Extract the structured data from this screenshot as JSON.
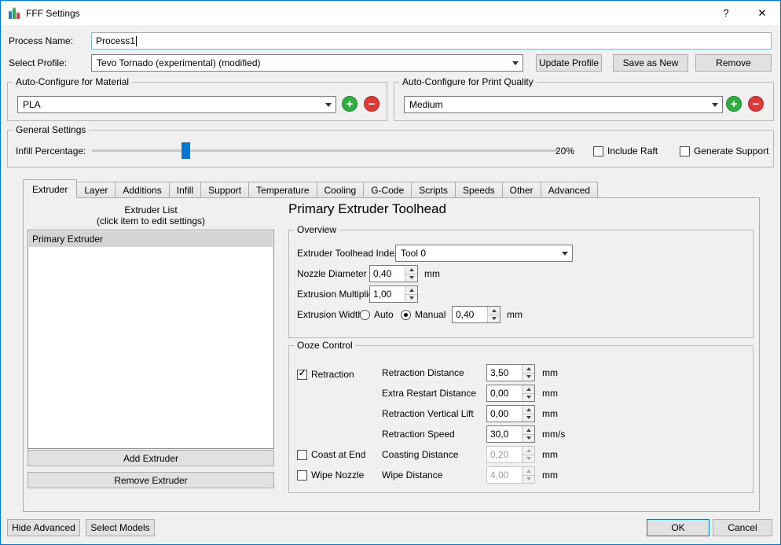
{
  "window": {
    "title": "FFF Settings",
    "help_glyph": "?",
    "close_glyph": "✕"
  },
  "icons": {
    "plus": "+",
    "minus": "−",
    "check": "✓"
  },
  "header": {
    "process_name_label": "Process Name:",
    "process_name_value": "Process1",
    "select_profile_label": "Select Profile:",
    "profile_value": "Tevo Tornado (experimental) (modified)",
    "update_profile": "Update Profile",
    "save_as_new": "Save as New",
    "remove": "Remove"
  },
  "auto_configure_material": {
    "title": "Auto-Configure for Material",
    "value": "PLA"
  },
  "auto_configure_quality": {
    "title": "Auto-Configure for Print Quality",
    "value": "Medium"
  },
  "general_settings": {
    "title": "General Settings",
    "infill_label": "Infill Percentage:",
    "infill_value": "20%",
    "infill_percent": 20,
    "include_raft": "Include Raft",
    "generate_support": "Generate Support"
  },
  "tabs": [
    "Extruder",
    "Layer",
    "Additions",
    "Infill",
    "Support",
    "Temperature",
    "Cooling",
    "G-Code",
    "Scripts",
    "Speeds",
    "Other",
    "Advanced"
  ],
  "extruder_tab": {
    "list_title": "Extruder List",
    "list_subtitle": "(click item to edit settings)",
    "list_items": [
      "Primary Extruder"
    ],
    "add_button": "Add Extruder",
    "remove_button": "Remove Extruder",
    "page_title": "Primary Extruder Toolhead",
    "overview": {
      "title": "Overview",
      "toolhead_index_label": "Extruder Toolhead Index",
      "toolhead_index_value": "Tool 0",
      "nozzle_diameter_label": "Nozzle Diameter",
      "nozzle_diameter_value": "0,40",
      "nozzle_diameter_unit": "mm",
      "extrusion_multiplier_label": "Extrusion Multiplier",
      "extrusion_multiplier_value": "1,00",
      "extrusion_width_label": "Extrusion Width",
      "auto_label": "Auto",
      "manual_label": "Manual",
      "extrusion_width_value": "0,40",
      "extrusion_width_unit": "mm"
    },
    "ooze_control": {
      "title": "Ooze Control",
      "retraction_label": "Retraction",
      "rows": [
        {
          "label": "Retraction Distance",
          "value": "3,50",
          "unit": "mm"
        },
        {
          "label": "Extra Restart Distance",
          "value": "0,00",
          "unit": "mm"
        },
        {
          "label": "Retraction Vertical Lift",
          "value": "0,00",
          "unit": "mm"
        },
        {
          "label": "Retraction Speed",
          "value": "30,0",
          "unit": "mm/s"
        }
      ],
      "coast_label": "Coast at End",
      "coasting_distance_label": "Coasting Distance",
      "coasting_distance_value": "0,20",
      "coasting_unit": "mm",
      "wipe_label": "Wipe Nozzle",
      "wipe_distance_label": "Wipe Distance",
      "wipe_distance_value": "4,00",
      "wipe_unit": "mm"
    }
  },
  "footer": {
    "hide_advanced": "Hide Advanced",
    "select_models": "Select Models",
    "ok": "OK",
    "cancel": "Cancel"
  }
}
